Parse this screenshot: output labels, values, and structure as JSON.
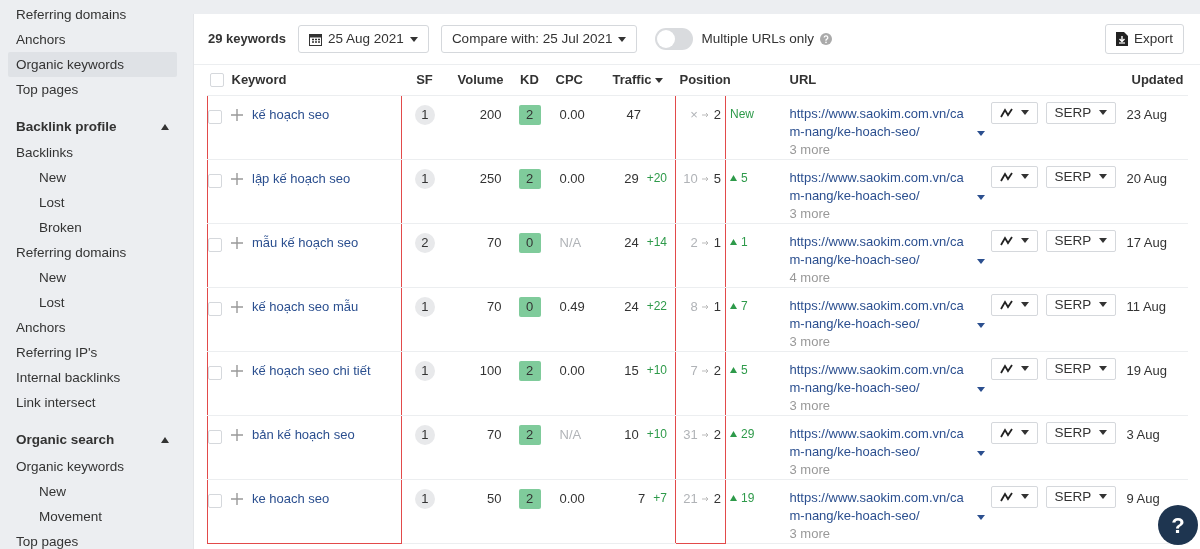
{
  "sidebar": {
    "items": [
      {
        "label": "Referring domains",
        "selected": false
      },
      {
        "label": "Anchors",
        "selected": false
      },
      {
        "label": "Organic keywords",
        "selected": true
      },
      {
        "label": "Top pages",
        "selected": false
      }
    ],
    "sections": [
      {
        "title": "Backlink profile",
        "expanded": true,
        "items": [
          {
            "label": "Backlinks",
            "selected": false,
            "children": [
              {
                "label": "New",
                "selected": false
              },
              {
                "label": "Lost",
                "selected": false
              },
              {
                "label": "Broken",
                "selected": false
              }
            ]
          },
          {
            "label": "Referring domains",
            "selected": false,
            "children": [
              {
                "label": "New",
                "selected": false
              },
              {
                "label": "Lost",
                "selected": false
              }
            ]
          },
          {
            "label": "Anchors",
            "selected": false
          },
          {
            "label": "Referring IP's",
            "selected": false
          },
          {
            "label": "Internal backlinks",
            "selected": false
          },
          {
            "label": "Link intersect",
            "selected": false
          }
        ]
      },
      {
        "title": "Organic search",
        "expanded": true,
        "items": [
          {
            "label": "Organic keywords",
            "selected": false,
            "children": [
              {
                "label": "New",
                "selected": false
              },
              {
                "label": "Movement",
                "selected": false
              }
            ]
          },
          {
            "label": "Top pages",
            "selected": false
          }
        ]
      }
    ]
  },
  "toolbar": {
    "count": "29 keywords",
    "date": "25 Aug 2021",
    "compare": "Compare with: 25 Jul 2021",
    "multiple_urls": {
      "label": "Multiple URLs only",
      "on": false
    },
    "export": "Export"
  },
  "table": {
    "header_checkbox": {
      "checked": false
    },
    "columns": [
      {
        "label": "Keyword",
        "sorted": false,
        "highlighted": true
      },
      {
        "label": "SF",
        "sorted": false,
        "highlighted": false
      },
      {
        "label": "Volume",
        "sorted": false,
        "highlighted": false
      },
      {
        "label": "KD",
        "sorted": false,
        "highlighted": false
      },
      {
        "label": "CPC",
        "sorted": false,
        "highlighted": false
      },
      {
        "label": "Traffic",
        "sorted": true,
        "highlighted": false
      },
      {
        "label": "Position",
        "sorted": false,
        "highlighted": true
      },
      {
        "label": "URL",
        "sorted": false,
        "highlighted": false
      },
      {
        "label": "Updated",
        "sorted": false,
        "highlighted": false
      }
    ],
    "rows": [
      {
        "checked": false,
        "keyword": "kế hoạch seo",
        "sf": "1",
        "volume": "200",
        "kd": "2",
        "cpc": "0.00",
        "cpc_na": false,
        "traffic": "47",
        "position_from": "×",
        "position_to": "2",
        "position_change": {
          "kind": "new",
          "text": "New"
        },
        "url": "https://www.saokim.com.vn/cam-nang/ke-hoach-seo/",
        "more": "3 more",
        "serp": "SERP",
        "updated": "23 Aug"
      },
      {
        "checked": false,
        "keyword": "lập kế hoạch seo",
        "sf": "1",
        "volume": "250",
        "kd": "2",
        "cpc": "0.00",
        "cpc_na": false,
        "traffic": "29",
        "traffic_change": "+20",
        "position_from": "10",
        "position_to": "5",
        "position_change": {
          "kind": "up",
          "text": "5"
        },
        "url": "https://www.saokim.com.vn/cam-nang/ke-hoach-seo/",
        "more": "3 more",
        "serp": "SERP",
        "updated": "20 Aug"
      },
      {
        "checked": false,
        "keyword": "mẫu kế hoạch seo",
        "sf": "2",
        "volume": "70",
        "kd": "0",
        "cpc": "N/A",
        "cpc_na": true,
        "traffic": "24",
        "traffic_change": "+14",
        "position_from": "2",
        "position_to": "1",
        "position_change": {
          "kind": "up",
          "text": "1"
        },
        "url": "https://www.saokim.com.vn/cam-nang/ke-hoach-seo/",
        "more": "4 more",
        "serp": "SERP",
        "updated": "17 Aug"
      },
      {
        "checked": false,
        "keyword": "kế hoạch seo mẫu",
        "sf": "1",
        "volume": "70",
        "kd": "0",
        "cpc": "0.49",
        "cpc_na": false,
        "traffic": "24",
        "traffic_change": "+22",
        "position_from": "8",
        "position_to": "1",
        "position_change": {
          "kind": "up",
          "text": "7"
        },
        "url": "https://www.saokim.com.vn/cam-nang/ke-hoach-seo/",
        "more": "3 more",
        "serp": "SERP",
        "updated": "11 Aug"
      },
      {
        "checked": false,
        "keyword": "kế hoạch seo chi tiết",
        "sf": "1",
        "volume": "100",
        "kd": "2",
        "cpc": "0.00",
        "cpc_na": false,
        "traffic": "15",
        "traffic_change": "+10",
        "position_from": "7",
        "position_to": "2",
        "position_change": {
          "kind": "up",
          "text": "5"
        },
        "url": "https://www.saokim.com.vn/cam-nang/ke-hoach-seo/",
        "more": "3 more",
        "serp": "SERP",
        "updated": "19 Aug"
      },
      {
        "checked": false,
        "keyword": "bản kế hoạch seo",
        "sf": "1",
        "volume": "70",
        "kd": "2",
        "cpc": "N/A",
        "cpc_na": true,
        "traffic": "10",
        "traffic_change": "+10",
        "position_from": "31",
        "position_to": "2",
        "position_change": {
          "kind": "up",
          "text": "29"
        },
        "url": "https://www.saokim.com.vn/cam-nang/ke-hoach-seo/",
        "more": "3 more",
        "serp": "SERP",
        "updated": "3 Aug"
      },
      {
        "checked": false,
        "keyword": "ke hoach seo",
        "sf": "1",
        "volume": "50",
        "kd": "2",
        "cpc": "0.00",
        "cpc_na": false,
        "traffic": "7",
        "traffic_change": "+7",
        "position_from": "21",
        "position_to": "2",
        "position_change": {
          "kind": "up",
          "text": "19"
        },
        "url": "https://www.saokim.com.vn/cam-nang/ke-hoach-seo/",
        "more": "3 more",
        "serp": "SERP",
        "updated": "9 Aug"
      }
    ]
  },
  "help": "?"
}
